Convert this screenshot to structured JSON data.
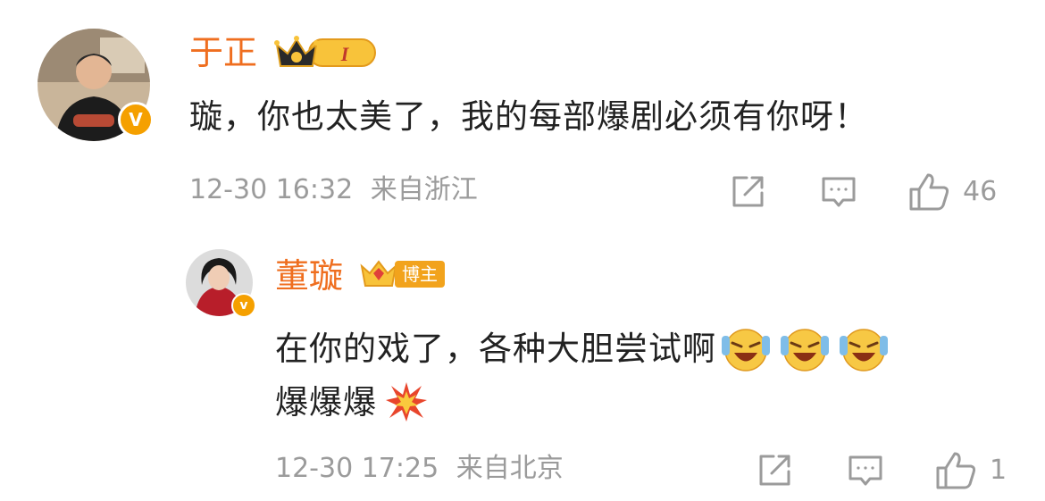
{
  "comments": [
    {
      "username": "于正",
      "badge_level": "I",
      "text": "璇，你也太美了，我的每部爆剧必须有你呀！",
      "time": "12-30 16:32",
      "location": "来自浙江",
      "likes": "46",
      "verified": "V"
    },
    {
      "username": "董璇",
      "badge_label": "博主",
      "text_line1": "在你的戏了，各种大胆尝试啊",
      "text_line2": "爆爆爆",
      "emojis": [
        "laugh-cry-emoji",
        "laugh-cry-emoji",
        "laugh-cry-emoji",
        "explosion-emoji"
      ],
      "time": "12-30 17:25",
      "location": "来自北京",
      "likes": "1",
      "verified": "v"
    }
  ],
  "icons": [
    "share-icon",
    "comment-icon",
    "like-icon"
  ],
  "colors": {
    "username": "#ef6e1f",
    "meta": "#9b9b9b",
    "badge": "#f5a000",
    "text": "#222222"
  }
}
